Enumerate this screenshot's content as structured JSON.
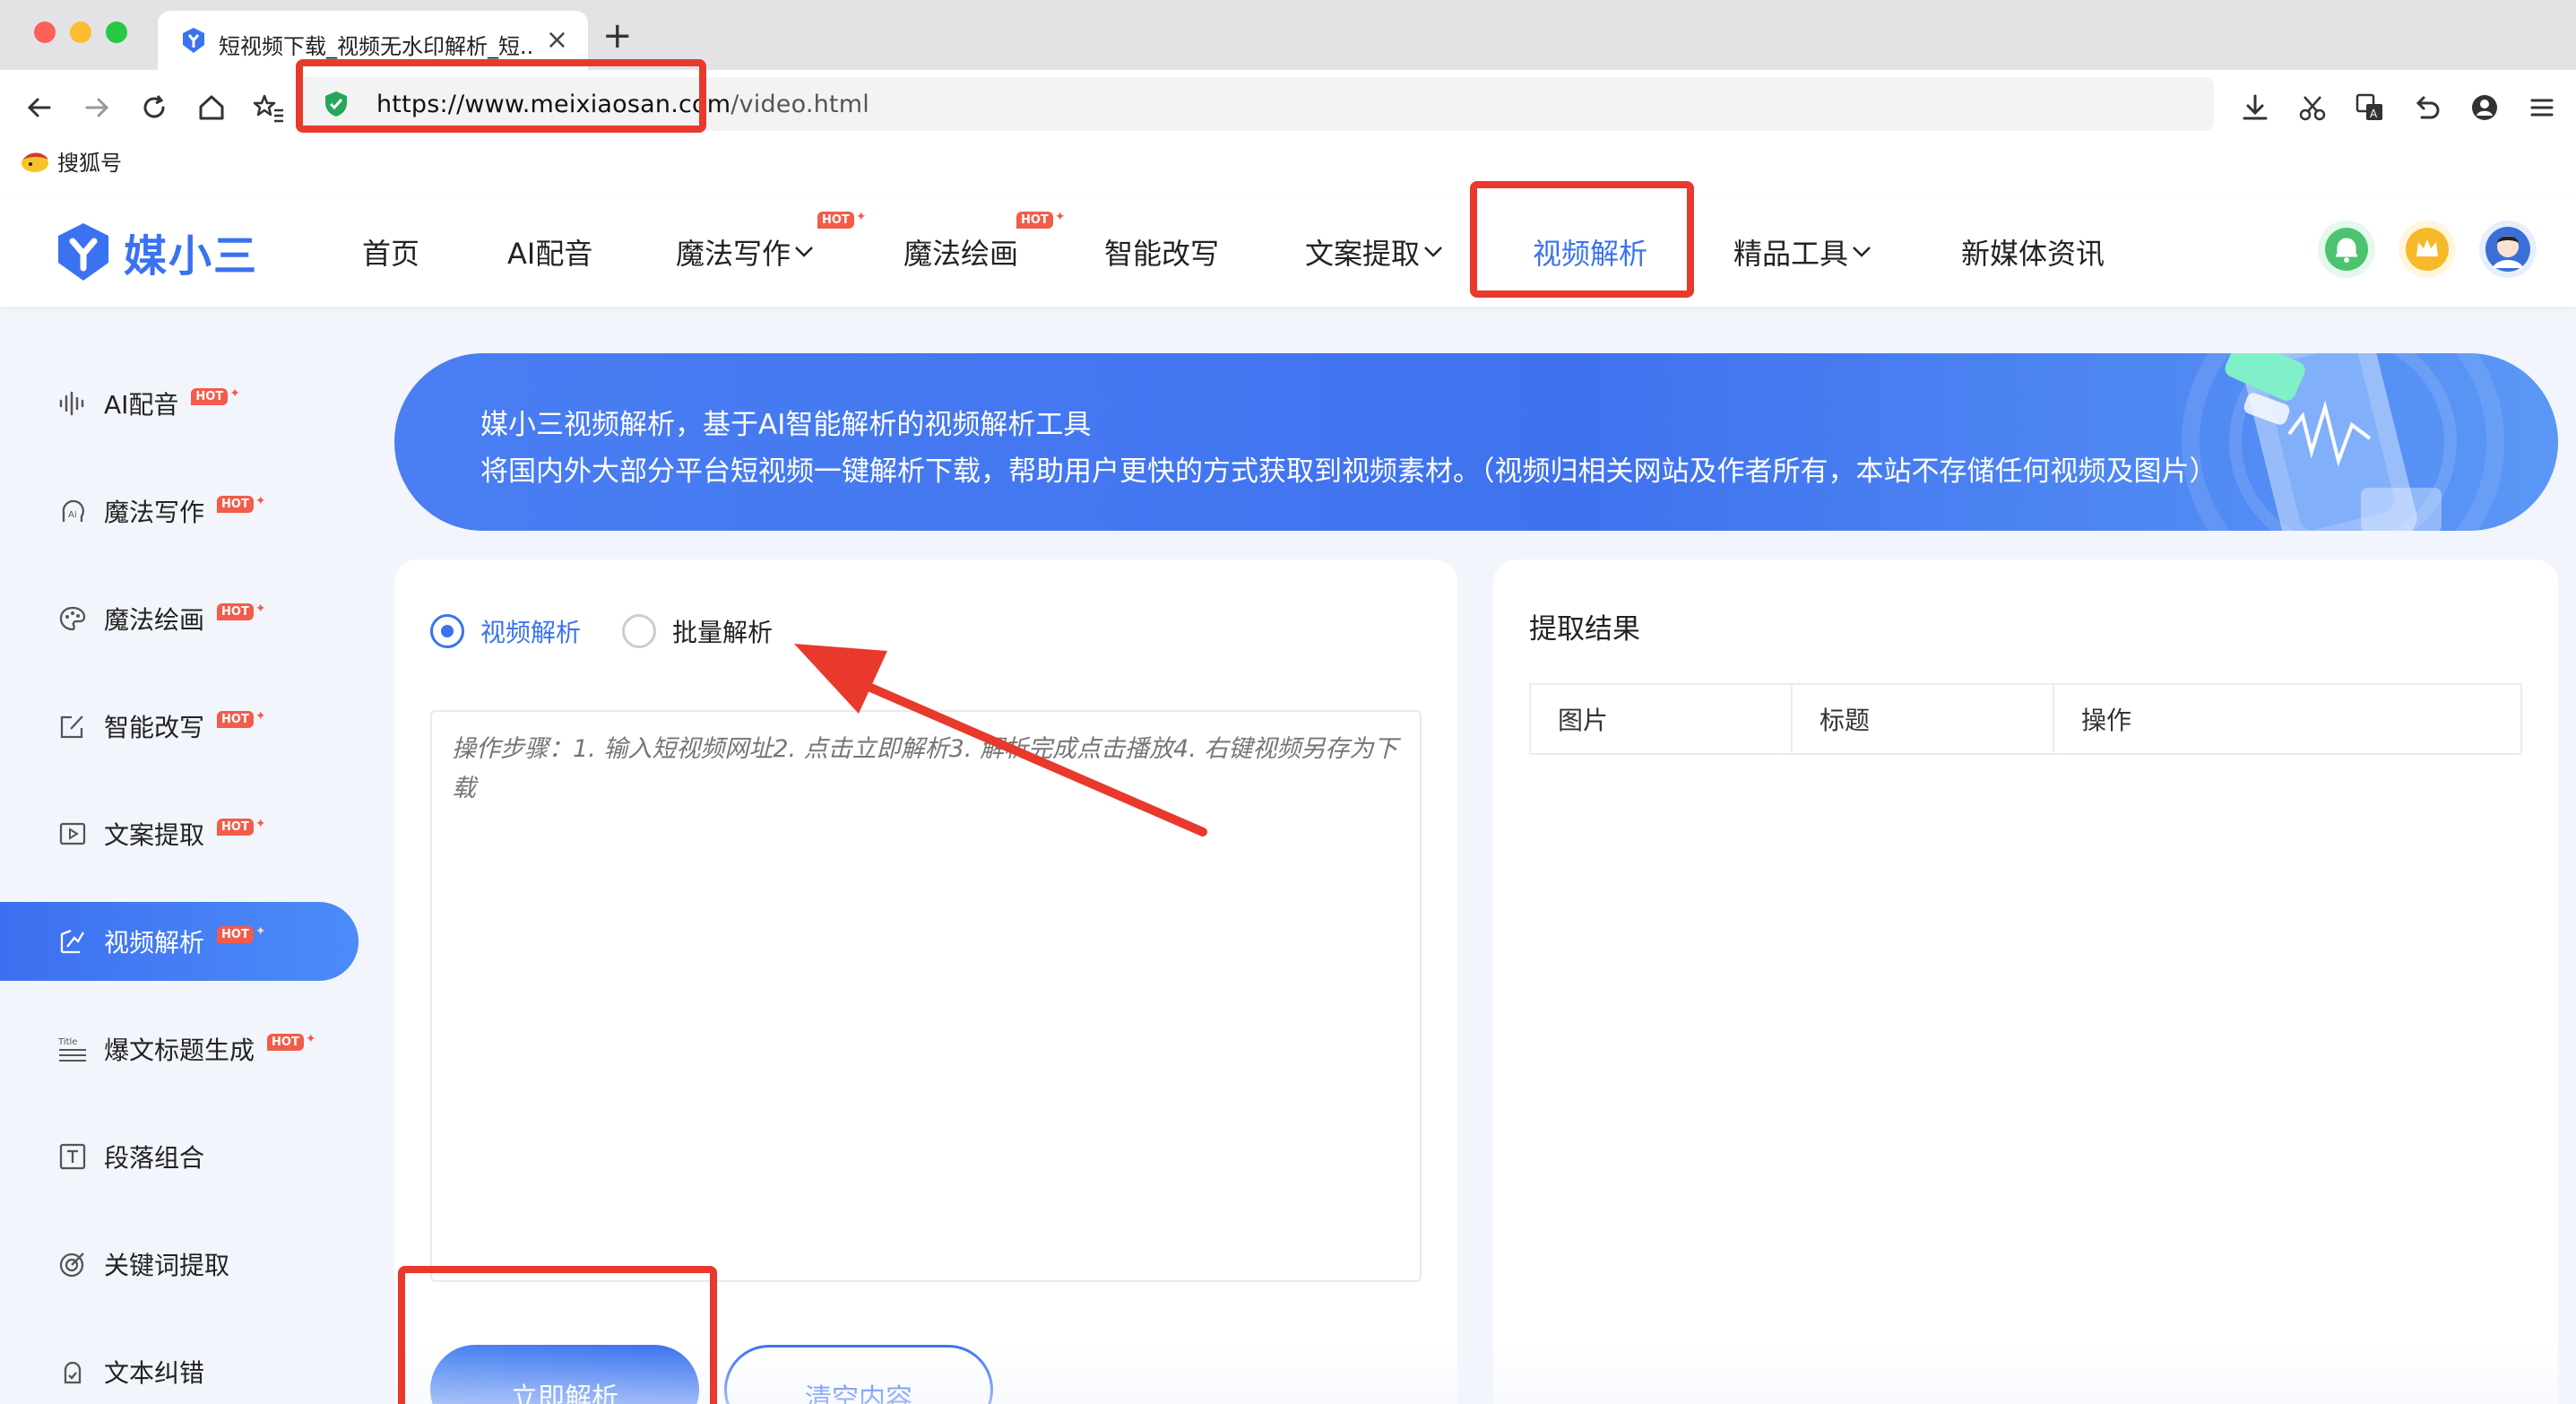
{
  "browser": {
    "tab_title": "短视频下载_视频无水印解析_短..",
    "tab_close": "×",
    "new_tab": "+",
    "url_main": "https://www.meixiaosan.com",
    "url_path": "/video.html",
    "bookmark": "搜狐号"
  },
  "header": {
    "logo_text": "媒小三",
    "nav": [
      {
        "label": "首页"
      },
      {
        "label": "AI配音"
      },
      {
        "label": "魔法写作"
      },
      {
        "label": "魔法绘画"
      },
      {
        "label": "智能改写"
      },
      {
        "label": "文案提取"
      },
      {
        "label": "视频解析"
      },
      {
        "label": "精品工具"
      },
      {
        "label": "新媒体资讯"
      }
    ],
    "hot_badge": "HOT"
  },
  "sidebar": {
    "items": [
      {
        "label": "AI配音",
        "hot": true
      },
      {
        "label": "魔法写作",
        "hot": true
      },
      {
        "label": "魔法绘画",
        "hot": true
      },
      {
        "label": "智能改写",
        "hot": true
      },
      {
        "label": "文案提取",
        "hot": true
      },
      {
        "label": "视频解析",
        "hot": true,
        "active": true
      },
      {
        "label": "爆文标题生成",
        "hot": true
      },
      {
        "label": "段落组合",
        "hot": false
      },
      {
        "label": "关键词提取",
        "hot": false
      },
      {
        "label": "文本纠错",
        "hot": false
      }
    ],
    "hot_badge": "HOT",
    "title_icon_text": "Title"
  },
  "banner": {
    "line1": "媒小三视频解析，基于AI智能解析的视频解析工具",
    "line2": "将国内外大部分平台短视频一键解析下载，帮助用户更快的方式获取到视频素材。（视频归相关网站及作者所有，本站不存储任何视频及图片）"
  },
  "parser": {
    "mode_single": "视频解析",
    "mode_batch": "批量解析",
    "input_placeholder": "操作步骤：1. 输入短视频网址2. 点击立即解析3. 解析完成点击播放4. 右键视频另存为下载",
    "parse_button": "立即解析",
    "clear_button": "清空内容"
  },
  "results": {
    "title": "提取结果",
    "columns": [
      "图片",
      "标题",
      "操作"
    ]
  },
  "colors": {
    "accent": "#3a72f0",
    "hot": "#f25c4a",
    "annotation_red": "#e8392c"
  }
}
